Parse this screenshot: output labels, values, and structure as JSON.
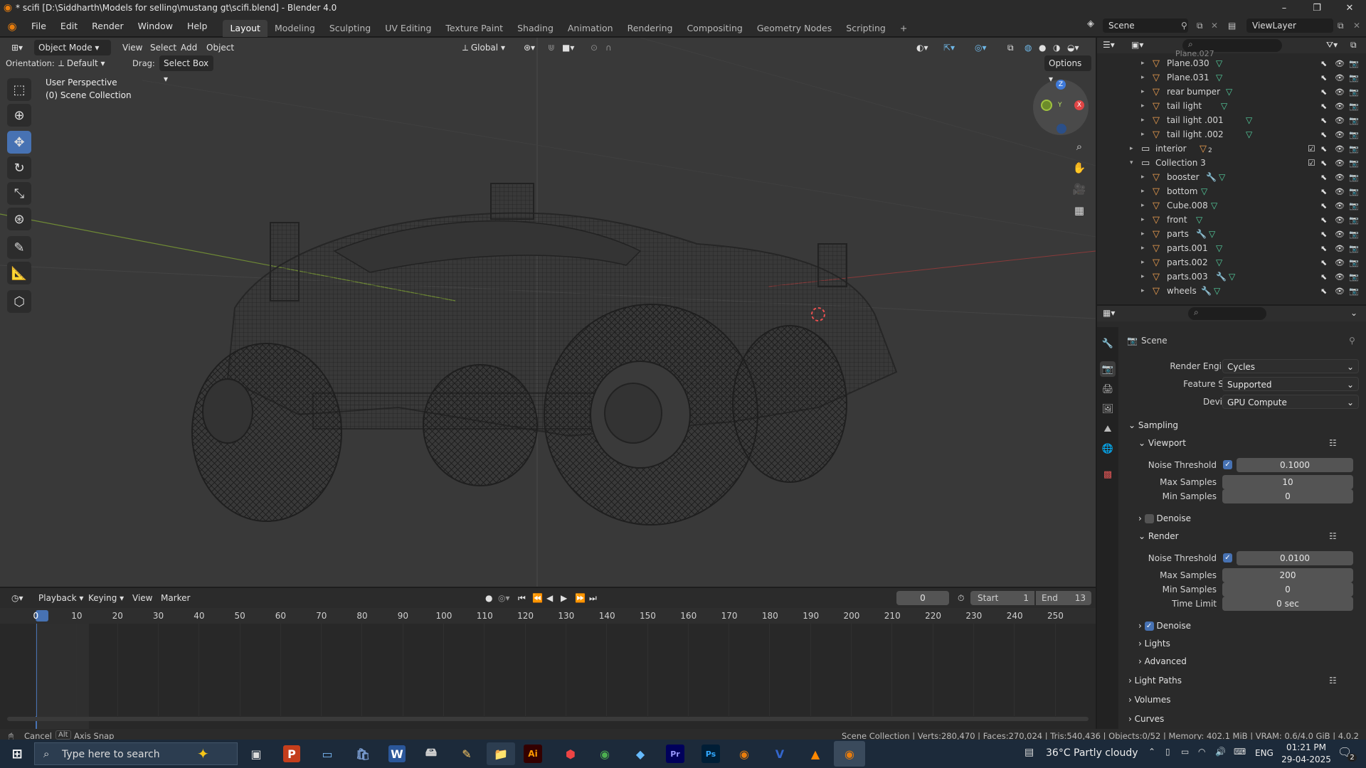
{
  "window": {
    "title": "* scifi [D:\\Siddharth\\Models for selling\\mustang gt\\scifi.blend] - Blender 4.0",
    "controls": [
      "–",
      "❐",
      "✕"
    ]
  },
  "menu": {
    "items": [
      "File",
      "Edit",
      "Render",
      "Window",
      "Help"
    ],
    "workspaces": [
      "Layout",
      "Modeling",
      "Sculpting",
      "UV Editing",
      "Texture Paint",
      "Shading",
      "Animation",
      "Rendering",
      "Compositing",
      "Geometry Nodes",
      "Scripting"
    ],
    "active_workspace": "Layout",
    "add_tab": "+",
    "scene_label": "Scene",
    "viewlayer_label": "ViewLayer"
  },
  "viewport_header": {
    "mode": "Object Mode",
    "menus": [
      "View",
      "Select",
      "Add",
      "Object"
    ],
    "transform_orientation": "Global",
    "orientation_label": "Orientation:",
    "orientation_value": "Default",
    "drag_label": "Drag:",
    "drag_value": "Select Box",
    "options": "Options"
  },
  "viewport": {
    "perspective": "User Perspective",
    "collection": "(0) Scene Collection",
    "gizmo": {
      "z": "Z",
      "y": "Y",
      "x": "X"
    }
  },
  "outliner": {
    "rows": [
      {
        "label": "Plane.030",
        "depth": 2,
        "type": "mesh"
      },
      {
        "label": "Plane.031",
        "depth": 2,
        "type": "mesh"
      },
      {
        "label": "rear bumper",
        "depth": 2,
        "type": "mesh"
      },
      {
        "label": "tail light",
        "depth": 2,
        "type": "mesh"
      },
      {
        "label": "tail light .001",
        "depth": 2,
        "type": "mesh"
      },
      {
        "label": "tail light .002",
        "depth": 2,
        "type": "mesh"
      },
      {
        "label": "interior",
        "depth": 1,
        "type": "collection",
        "badge": "2"
      },
      {
        "label": "Collection 3",
        "depth": 1,
        "type": "collection"
      },
      {
        "label": "booster",
        "depth": 2,
        "type": "mesh-mod"
      },
      {
        "label": "bottom",
        "depth": 2,
        "type": "mesh"
      },
      {
        "label": "Cube.008",
        "depth": 2,
        "type": "mesh"
      },
      {
        "label": "front",
        "depth": 2,
        "type": "mesh"
      },
      {
        "label": "parts",
        "depth": 2,
        "type": "mesh-mod"
      },
      {
        "label": "parts.001",
        "depth": 2,
        "type": "mesh"
      },
      {
        "label": "parts.002",
        "depth": 2,
        "type": "mesh"
      },
      {
        "label": "parts.003",
        "depth": 2,
        "type": "mesh-mod"
      },
      {
        "label": "wheels",
        "depth": 2,
        "type": "mesh-mod"
      }
    ],
    "partial_top": "Plane.027"
  },
  "properties": {
    "context": "Scene",
    "render_engine_label": "Render Engine",
    "render_engine": "Cycles",
    "feature_set_label": "Feature Set",
    "feature_set": "Supported",
    "device_label": "Device",
    "device": "GPU Compute",
    "sampling": "Sampling",
    "viewport": {
      "title": "Viewport",
      "noise_threshold_label": "Noise Threshold",
      "noise_threshold": "0.1000",
      "max_samples_label": "Max Samples",
      "max_samples": "10",
      "min_samples_label": "Min Samples",
      "min_samples": "0",
      "denoise": "Denoise"
    },
    "render": {
      "title": "Render",
      "noise_threshold_label": "Noise Threshold",
      "noise_threshold": "0.0100",
      "max_samples_label": "Max Samples",
      "max_samples": "200",
      "min_samples_label": "Min Samples",
      "min_samples": "0",
      "time_limit_label": "Time Limit",
      "time_limit": "0 sec",
      "denoise": "Denoise"
    },
    "lights": "Lights",
    "advanced": "Advanced",
    "light_paths": "Light Paths",
    "volumes": "Volumes",
    "curves": "Curves"
  },
  "timeline": {
    "menus": [
      "Playback",
      "Keying",
      "View",
      "Marker"
    ],
    "current_frame": "0",
    "start_label": "Start",
    "start": "1",
    "end_label": "End",
    "end": "13",
    "ticks": [
      "0",
      "10",
      "20",
      "30",
      "40",
      "50",
      "60",
      "70",
      "80",
      "90",
      "100",
      "110",
      "120",
      "130",
      "140",
      "150",
      "160",
      "170",
      "180",
      "190",
      "200",
      "210",
      "220",
      "230",
      "240",
      "250"
    ]
  },
  "status": {
    "cancel": "Cancel",
    "alt": "Alt",
    "axis_snap": "Axis Snap",
    "stats": "Scene Collection | Verts:280,470 | Faces:270,024 | Tris:540,436 | Objects:0/52 | Memory: 402.1 MiB | VRAM: 0.6/4.0 GiB | 4.0.2"
  },
  "taskbar": {
    "search_placeholder": "Type here to search",
    "weather": "36°C  Partly cloudy",
    "lang": "ENG",
    "time": "01:21 PM",
    "date": "29-04-2025",
    "notifications": "2",
    "apps": [
      "task-view",
      "powerpoint",
      "desktop",
      "store",
      "word",
      "explorer-drive",
      "notes",
      "file-explorer",
      "illustrator",
      "pin-app",
      "chrome",
      "m365",
      "premiere",
      "photoshop",
      "blender-alt",
      "vectr",
      "vlc",
      "blender"
    ]
  },
  "colors": {
    "accent": "#4772b3",
    "blender_orange": "#e87d0d",
    "mesh_green": "#55d0a0",
    "modifier_blue": "#6fb8e8",
    "object_orange": "#f0a050"
  }
}
